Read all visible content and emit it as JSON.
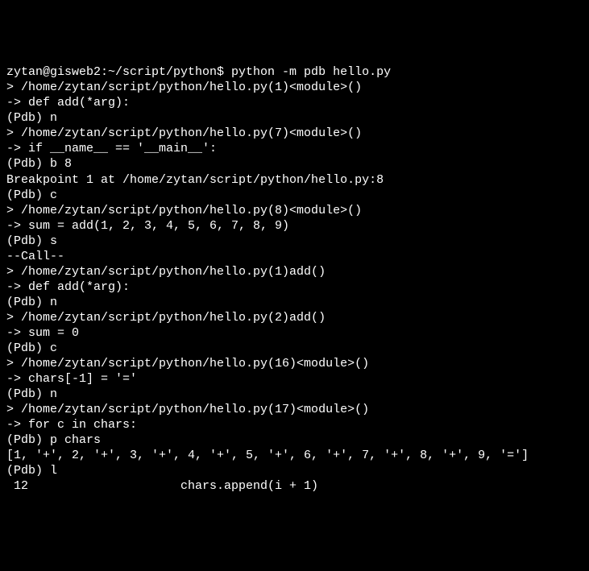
{
  "terminal": {
    "lines": [
      "zytan@gisweb2:~/script/python$ python -m pdb hello.py",
      "> /home/zytan/script/python/hello.py(1)<module>()",
      "-> def add(*arg):",
      "(Pdb) n",
      "> /home/zytan/script/python/hello.py(7)<module>()",
      "-> if __name__ == '__main__':",
      "(Pdb) b 8",
      "Breakpoint 1 at /home/zytan/script/python/hello.py:8",
      "(Pdb) c",
      "> /home/zytan/script/python/hello.py(8)<module>()",
      "-> sum = add(1, 2, 3, 4, 5, 6, 7, 8, 9)",
      "(Pdb) s",
      "--Call--",
      "> /home/zytan/script/python/hello.py(1)add()",
      "-> def add(*arg):",
      "(Pdb) n",
      "> /home/zytan/script/python/hello.py(2)add()",
      "-> sum = 0",
      "(Pdb) c",
      "> /home/zytan/script/python/hello.py(16)<module>()",
      "-> chars[-1] = '='",
      "(Pdb) n",
      "> /home/zytan/script/python/hello.py(17)<module>()",
      "-> for c in chars:",
      "(Pdb) p chars",
      "[1, '+', 2, '+', 3, '+', 4, '+', 5, '+', 6, '+', 7, '+', 8, '+', 9, '=']",
      "(Pdb) l",
      " 12                     chars.append(i + 1)"
    ]
  }
}
